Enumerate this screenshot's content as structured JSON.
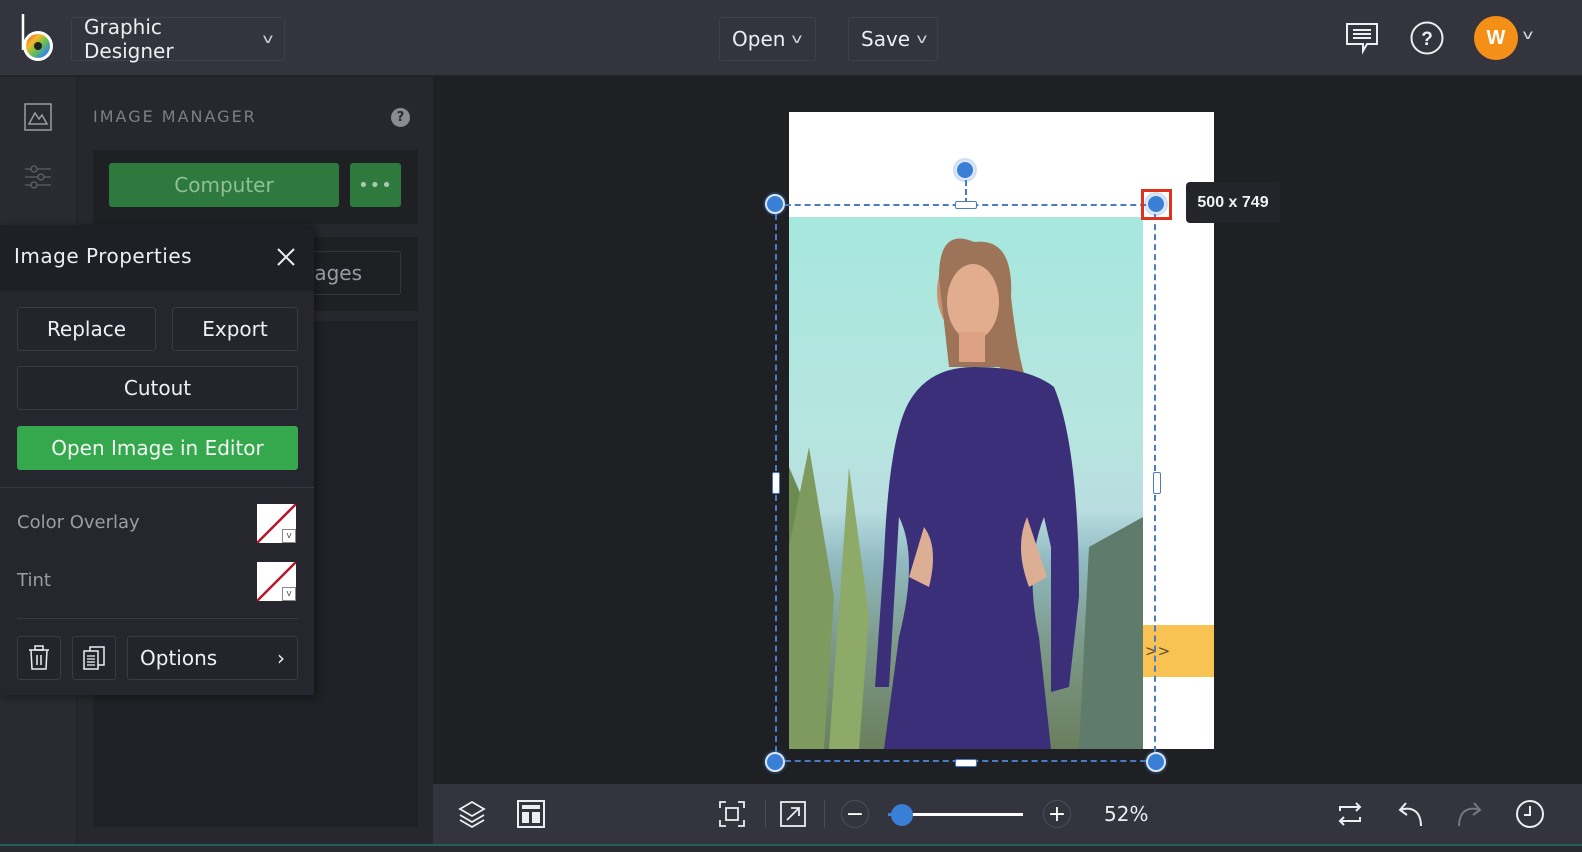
{
  "header": {
    "app_menu_label": "Graphic Designer",
    "open_label": "Open",
    "save_label": "Save",
    "user_initial": "W",
    "icons": [
      "logo",
      "chevron-down-icon",
      "chat-icon",
      "help-icon",
      "avatar",
      "chevron-down-icon"
    ]
  },
  "sidebar": {
    "icons": [
      {
        "name": "image-icon",
        "active": true
      },
      {
        "name": "sliders-icon",
        "active": false
      }
    ]
  },
  "image_manager": {
    "title": "IMAGE MANAGER",
    "help_label": "?",
    "computer_label": "Computer",
    "more_label": "•••",
    "images_tab_label": "ages"
  },
  "image_properties": {
    "title": "Image Properties",
    "replace_label": "Replace",
    "export_label": "Export",
    "cutout_label": "Cutout",
    "open_editor_label": "Open Image in Editor",
    "color_overlay_label": "Color Overlay",
    "tint_label": "Tint",
    "options_label": "Options",
    "options_chevron": "›"
  },
  "canvas": {
    "size_tooltip": "500 x 749",
    "banner_text": ">>",
    "colors": {
      "selection": "#4a7cc6",
      "highlight": "#e0301e",
      "banner": "#f8c352"
    }
  },
  "bottom_toolbar": {
    "zoom_out_label": "−",
    "zoom_in_label": "+",
    "zoom_value": "52%",
    "zoom_slider_fraction": 0.1
  },
  "colors": {
    "accent_green": "#35a84d",
    "dark_green": "#2e7a3e",
    "avatar_orange": "#f49018",
    "handle_blue": "#3a7fd6"
  }
}
